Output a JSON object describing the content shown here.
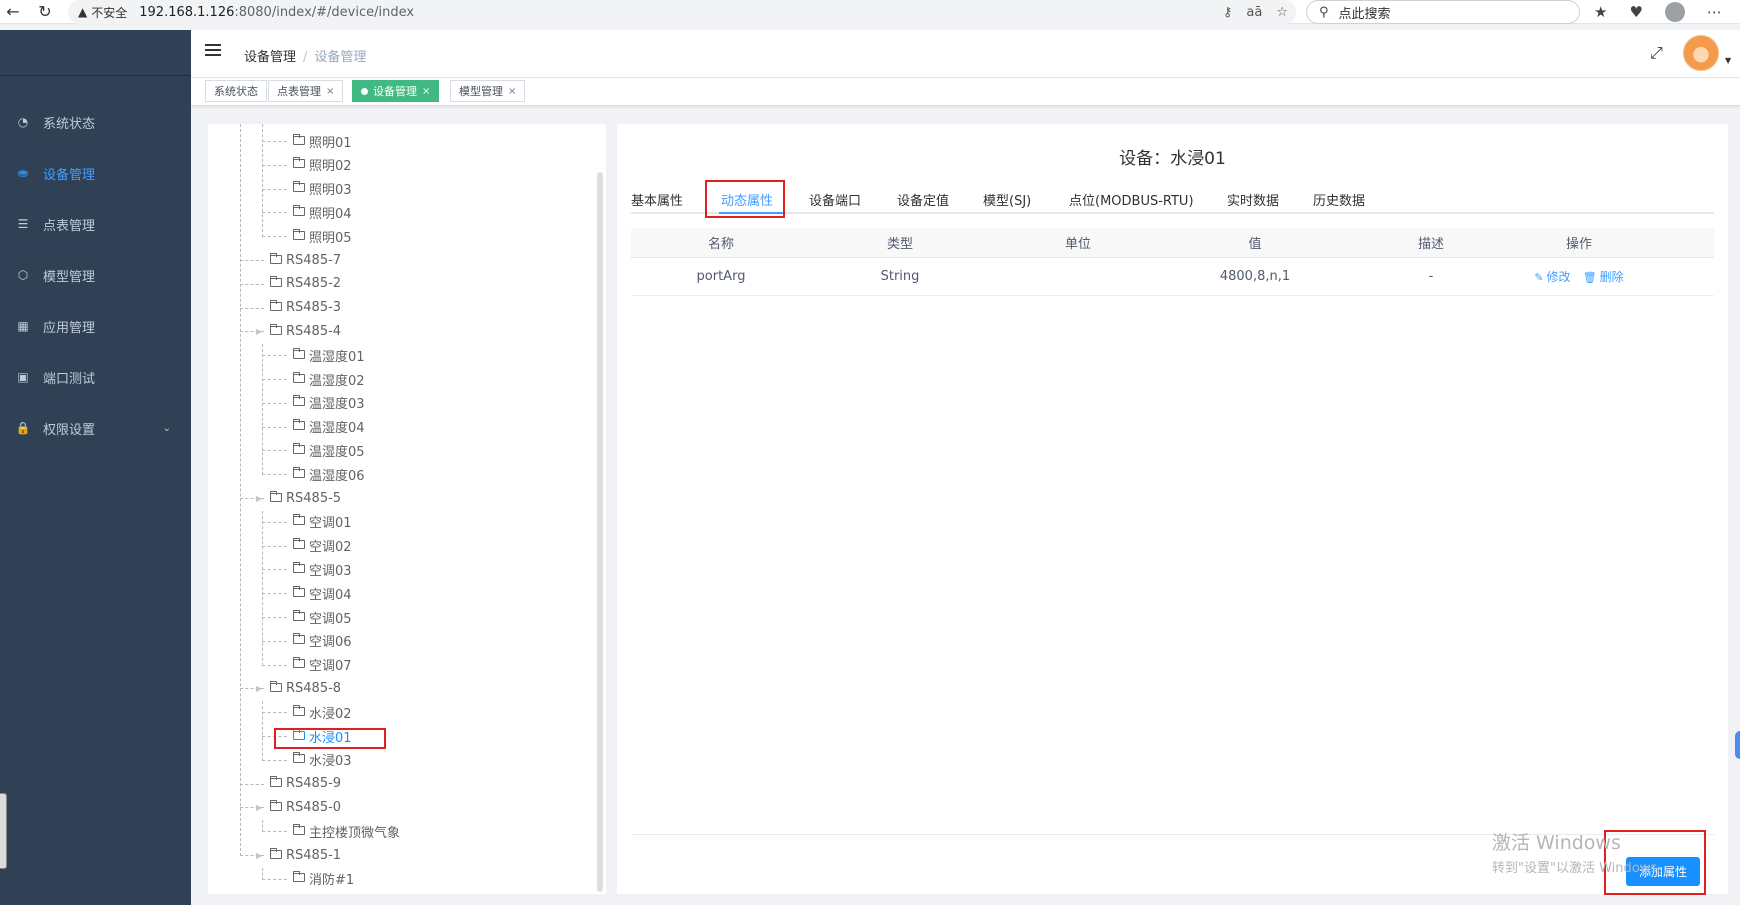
{
  "browser": {
    "insecure_label": "不安全",
    "url_host": "192.168.1.126",
    "url_rest": ":8080/index/#/device/index",
    "search_placeholder": "点此搜索"
  },
  "sidebar": {
    "items": [
      {
        "label": "系统状态",
        "icon": "dashboard-icon"
      },
      {
        "label": "设备管理",
        "icon": "tree-icon",
        "active": true
      },
      {
        "label": "点表管理",
        "icon": "list-icon"
      },
      {
        "label": "模型管理",
        "icon": "cube-icon"
      },
      {
        "label": "应用管理",
        "icon": "apps-icon"
      },
      {
        "label": "端口测试",
        "icon": "port-icon"
      },
      {
        "label": "权限设置",
        "icon": "lock-icon",
        "expandable": true
      }
    ]
  },
  "header": {
    "breadcrumb": [
      "设备管理",
      "设备管理"
    ]
  },
  "tags": [
    {
      "label": "系统状态",
      "closable": false
    },
    {
      "label": "点表管理",
      "closable": true
    },
    {
      "label": "设备管理",
      "closable": true,
      "active": true
    },
    {
      "label": "模型管理",
      "closable": true
    }
  ],
  "tree": {
    "nodes": [
      {
        "label": "照明01",
        "level": 2
      },
      {
        "label": "照明02",
        "level": 2
      },
      {
        "label": "照明03",
        "level": 2
      },
      {
        "label": "照明04",
        "level": 2
      },
      {
        "label": "照明05",
        "level": 2
      },
      {
        "label": "RS485-7",
        "level": 1
      },
      {
        "label": "RS485-2",
        "level": 1
      },
      {
        "label": "RS485-3",
        "level": 1
      },
      {
        "label": "RS485-4",
        "level": 1,
        "expandable": true
      },
      {
        "label": "温湿度01",
        "level": 2
      },
      {
        "label": "温湿度02",
        "level": 2
      },
      {
        "label": "温湿度03",
        "level": 2
      },
      {
        "label": "温湿度04",
        "level": 2
      },
      {
        "label": "温湿度05",
        "level": 2
      },
      {
        "label": "温湿度06",
        "level": 2
      },
      {
        "label": "RS485-5",
        "level": 1,
        "expandable": true
      },
      {
        "label": "空调01",
        "level": 2
      },
      {
        "label": "空调02",
        "level": 2
      },
      {
        "label": "空调03",
        "level": 2
      },
      {
        "label": "空调04",
        "level": 2
      },
      {
        "label": "空调05",
        "level": 2
      },
      {
        "label": "空调06",
        "level": 2
      },
      {
        "label": "空调07",
        "level": 2
      },
      {
        "label": "RS485-8",
        "level": 1,
        "expandable": true
      },
      {
        "label": "水浸02",
        "level": 2
      },
      {
        "label": "水浸01",
        "level": 2,
        "selected": true
      },
      {
        "label": "水浸03",
        "level": 2
      },
      {
        "label": "RS485-9",
        "level": 1
      },
      {
        "label": "RS485-0",
        "level": 1,
        "expandable": true
      },
      {
        "label": "主控楼顶微气象",
        "level": 2
      },
      {
        "label": "RS485-1",
        "level": 1,
        "expandable": true
      },
      {
        "label": "消防#1",
        "level": 2
      }
    ]
  },
  "detail": {
    "title": "设备：水浸01",
    "tabs": [
      "基本属性",
      "动态属性",
      "设备端口",
      "设备定值",
      "模型(SJ)",
      "点位(MODBUS-RTU)",
      "实时数据",
      "历史数据"
    ],
    "active_tab": 1,
    "table": {
      "headers": [
        "名称",
        "类型",
        "单位",
        "值",
        "描述",
        "操作"
      ],
      "rows": [
        {
          "name": "portArg",
          "type": "String",
          "unit": "",
          "value": "4800,8,n,1",
          "desc": "-"
        }
      ],
      "edit_label": "修改",
      "delete_label": "删除"
    },
    "add_button": "添加属性"
  },
  "watermark": {
    "line1": "激活 Windows",
    "line2": "转到\"设置\"以激活 Windows。"
  }
}
